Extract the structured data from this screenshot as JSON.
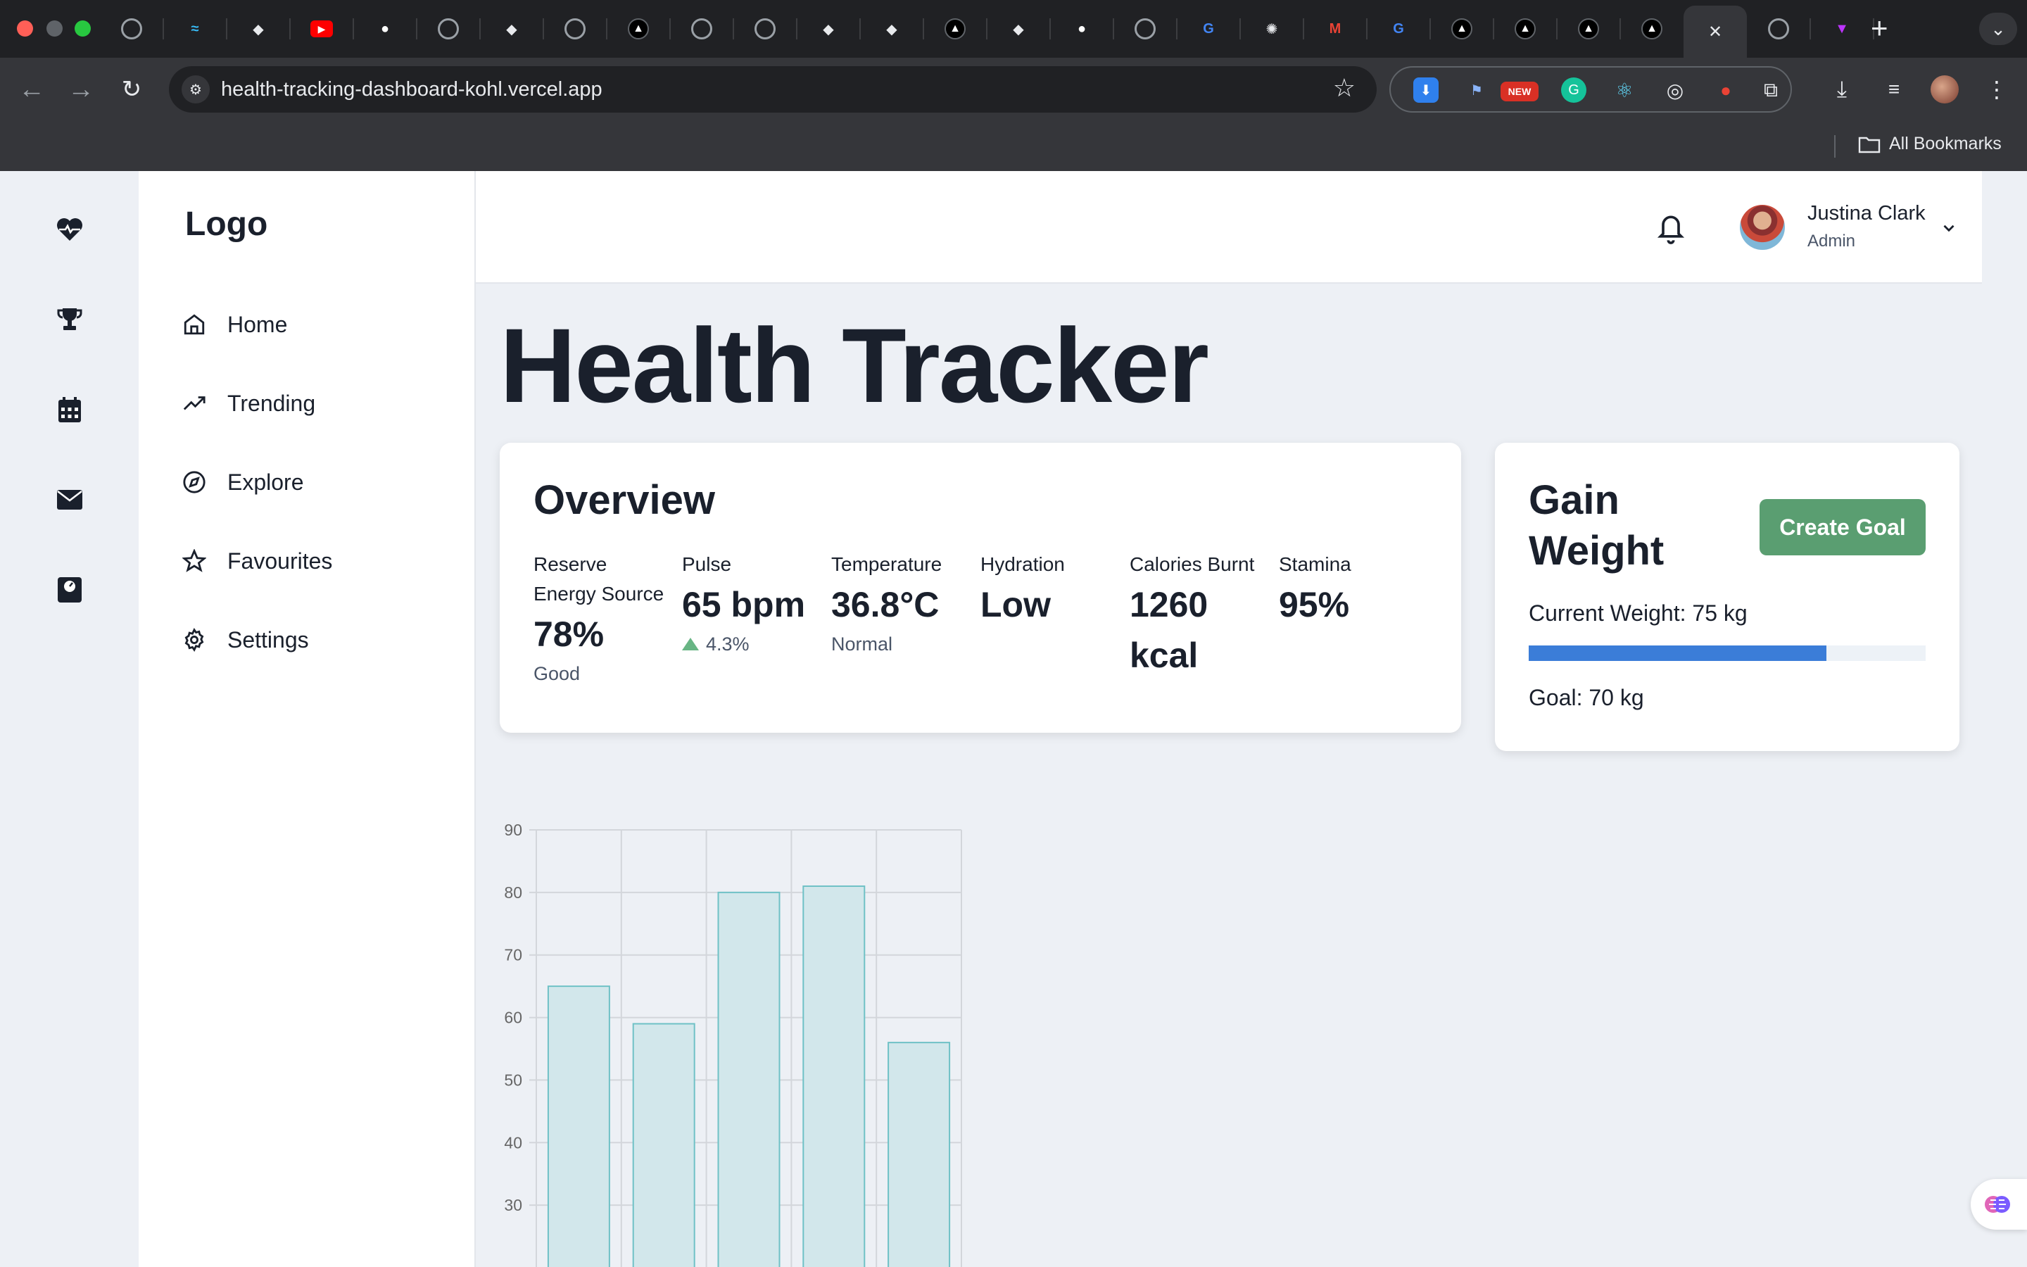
{
  "browser": {
    "tabs": [
      {
        "icon": "globe-icon"
      },
      {
        "icon": "tailwind-icon"
      },
      {
        "icon": "app-icon"
      },
      {
        "icon": "youtube-icon"
      },
      {
        "icon": "github-icon"
      },
      {
        "icon": "globe-icon"
      },
      {
        "icon": "app-icon"
      },
      {
        "icon": "chrome-icon"
      },
      {
        "icon": "vercel-icon"
      },
      {
        "icon": "globe-icon"
      },
      {
        "icon": "globe-icon"
      },
      {
        "icon": "app-icon"
      },
      {
        "icon": "app-icon"
      },
      {
        "icon": "vercel-icon"
      },
      {
        "icon": "app-icon"
      },
      {
        "icon": "github-icon"
      },
      {
        "icon": "chrome-icon"
      },
      {
        "icon": "google-icon"
      },
      {
        "icon": "openai-icon"
      },
      {
        "icon": "gmail-icon"
      },
      {
        "icon": "google-icon"
      },
      {
        "icon": "vercel-icon"
      },
      {
        "icon": "vercel-icon"
      },
      {
        "icon": "vercel-icon"
      },
      {
        "icon": "vercel-icon"
      },
      {
        "icon": "close-icon",
        "active": true
      },
      {
        "icon": "globe-icon"
      },
      {
        "icon": "vite-icon"
      }
    ],
    "url": "health-tracking-dashboard-kohl.vercel.app",
    "extension_badge": "NEW",
    "bookmarks_label": "All Bookmarks"
  },
  "sidebar": {
    "logo": "Logo",
    "items": [
      {
        "label": "Home",
        "icon": "home-icon"
      },
      {
        "label": "Trending",
        "icon": "trending-icon"
      },
      {
        "label": "Explore",
        "icon": "compass-icon"
      },
      {
        "label": "Favourites",
        "icon": "star-icon"
      },
      {
        "label": "Settings",
        "icon": "gear-icon"
      }
    ]
  },
  "rail": [
    "heart-pulse-icon",
    "trophy-icon",
    "calendar-icon",
    "envelope-icon",
    "scale-icon"
  ],
  "header": {
    "user_name": "Justina Clark",
    "user_role": "Admin"
  },
  "page_title": "Health Tracker",
  "overview": {
    "title": "Overview",
    "metrics": [
      {
        "label": "Reserve Energy Source",
        "value": "78%",
        "sub": "Good"
      },
      {
        "label": "Pulse",
        "value": "65 bpm",
        "trend": "4.3%"
      },
      {
        "label": "Temperature",
        "value": "36.8°C",
        "sub": "Normal"
      },
      {
        "label": "Hydration",
        "value": "Low"
      },
      {
        "label": "Calories Burnt",
        "value": "1260 kcal"
      },
      {
        "label": "Stamina",
        "value": "95%"
      }
    ]
  },
  "goal": {
    "title": "Gain Weight",
    "button": "Create Goal",
    "current": "Current Weight: 75 kg",
    "target": "Goal: 70 kg",
    "progress": 0.75
  },
  "colors": {
    "accent_green": "#5a9e71",
    "progress_blue": "#3b7dd8",
    "bar_fill": "#d2e7eb",
    "bar_stroke": "#6fc1c6",
    "trend_up": "#68b584"
  },
  "chart_data": {
    "type": "bar",
    "values": [
      65,
      59,
      80,
      81,
      56
    ],
    "yticks": [
      30,
      40,
      50,
      60,
      70,
      80,
      90
    ],
    "ylim": [
      20,
      90
    ],
    "grid": true
  }
}
